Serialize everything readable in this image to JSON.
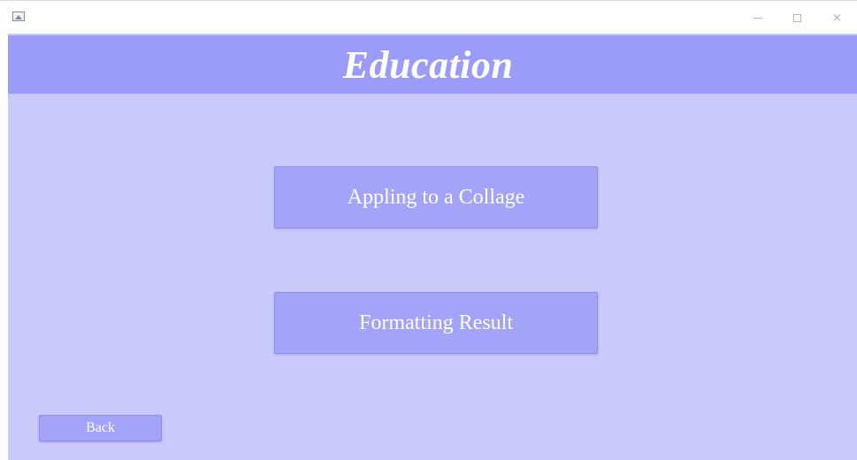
{
  "window": {
    "minimize_glyph": "",
    "maximize_glyph": "",
    "close_glyph": "×"
  },
  "header": {
    "title": "Education"
  },
  "main": {
    "buttons": [
      {
        "label": "Appling to a Collage"
      },
      {
        "label": "Formatting Result"
      }
    ]
  },
  "footer": {
    "back_label": "Back"
  },
  "colors": {
    "background": "#c9c9fb",
    "header_band": "#9b9bf9",
    "button_fill": "#a3a3fa",
    "text": "#ffffff"
  },
  "icons": {
    "app": "app-image-icon",
    "minimize": "minimize-icon",
    "maximize": "maximize-icon",
    "close": "close-icon"
  }
}
